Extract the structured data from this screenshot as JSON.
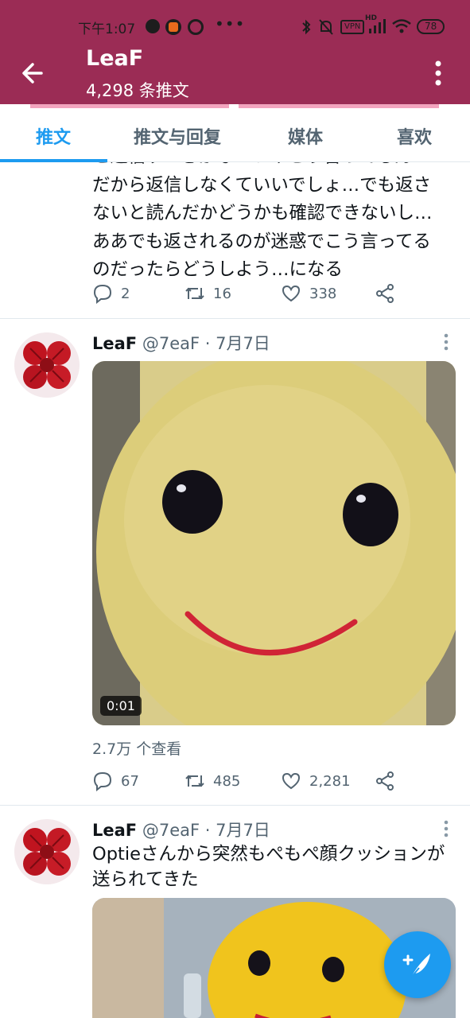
{
  "status_bar": {
    "time": "下午1:07",
    "vpn": "VPN",
    "hd": "HD",
    "battery": "78"
  },
  "header": {
    "title": "LeaF",
    "subtitle": "4,298 条推文"
  },
  "tabs": [
    {
      "label": "推文",
      "active": true
    },
    {
      "label": "推文与回复",
      "active": false
    },
    {
      "label": "媒体",
      "active": false
    },
    {
      "label": "喜欢",
      "active": false
    }
  ],
  "tweets": [
    {
      "text_lines": [
        "と返信すべきかな…いやこう言ってるん",
        "だから返信しなくていいでしょ…でも返さ",
        "ないと読んだかどうかも確認できないし…",
        "ああでも返されるのが迷惑でこう言ってる",
        "のだったらどうしよう…になる"
      ],
      "replies": "2",
      "retweets": "16",
      "likes": "338"
    },
    {
      "name": "LeaF",
      "handle_date": "@7eaF · 7月7日",
      "video_duration": "0:01",
      "views": "2.7万 个查看",
      "replies": "67",
      "retweets": "485",
      "likes": "2,281"
    },
    {
      "name": "LeaF",
      "handle_date": "@7eaF · 7月7日",
      "text": "Optieさんから突然もぺもぺ顔クッションが送られてきた"
    }
  ],
  "colors": {
    "header_bg": "#9b2c55",
    "accent": "#1d9bf0",
    "muted": "#536471"
  }
}
